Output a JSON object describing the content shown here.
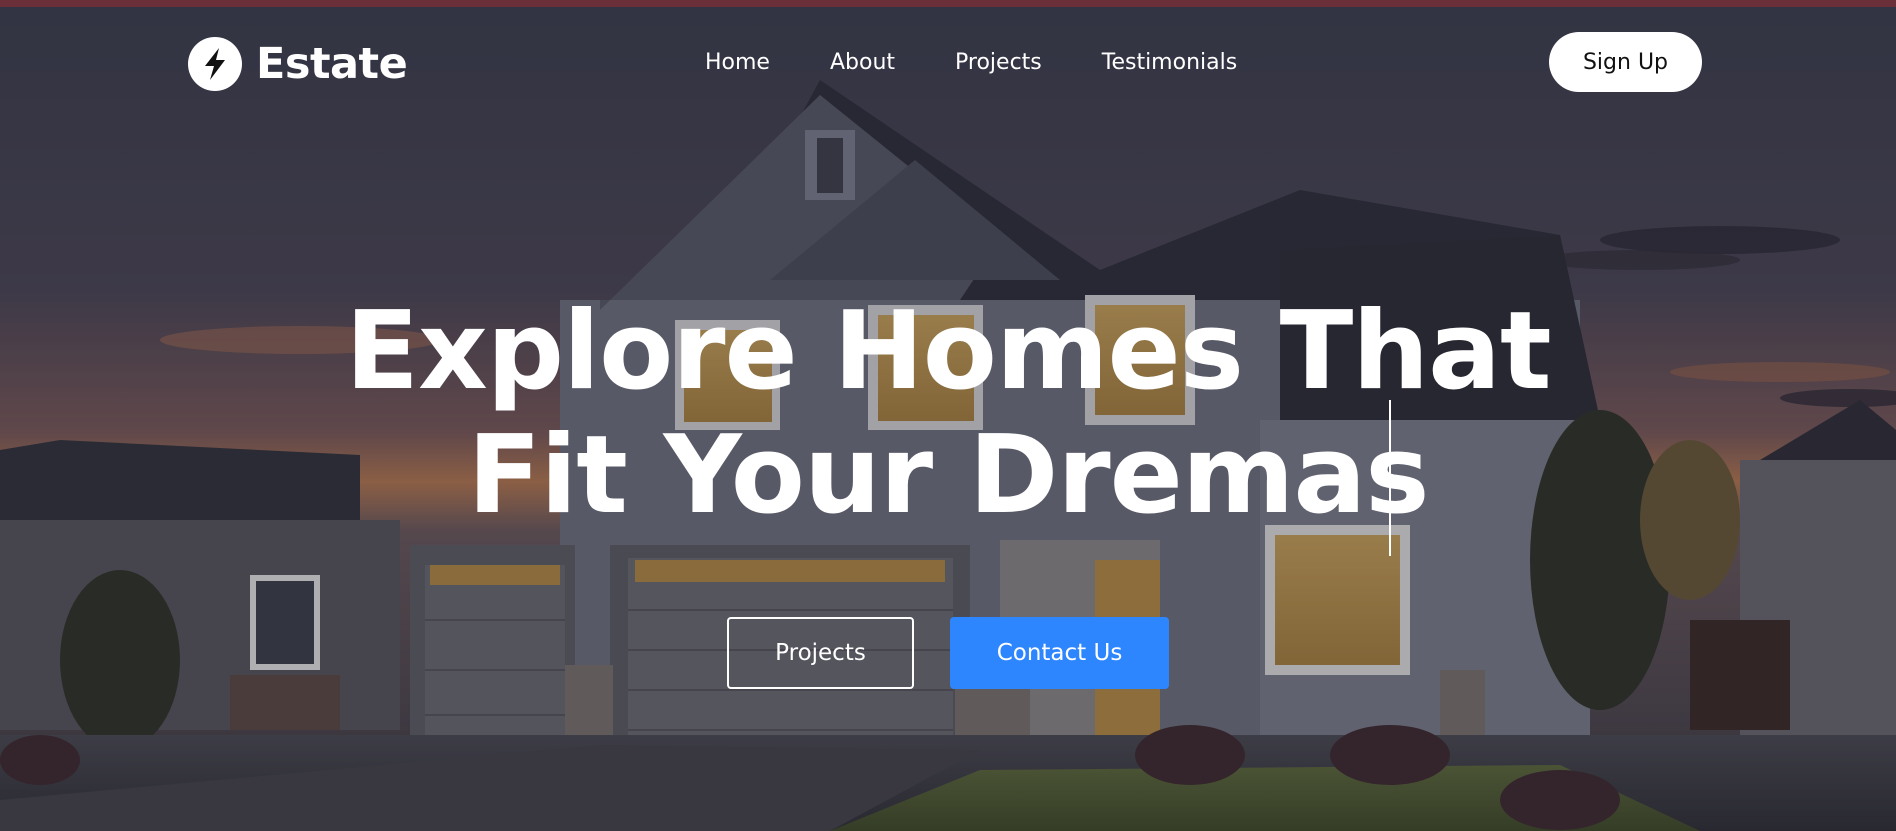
{
  "brand": {
    "name": "Estate",
    "logo_icon": "lightning-bolt-icon",
    "accent_color": "#2e86ff"
  },
  "nav": {
    "items": [
      {
        "label": "Home"
      },
      {
        "label": "About"
      },
      {
        "label": "Projects"
      },
      {
        "label": "Testimonials"
      }
    ],
    "signup_label": "Sign Up"
  },
  "hero": {
    "headline_line1": "Explore Homes That",
    "headline_line2": "Fit Your Dremas",
    "primary_cta": "Contact Us",
    "secondary_cta": "Projects",
    "background": "house-at-dusk-photo"
  }
}
